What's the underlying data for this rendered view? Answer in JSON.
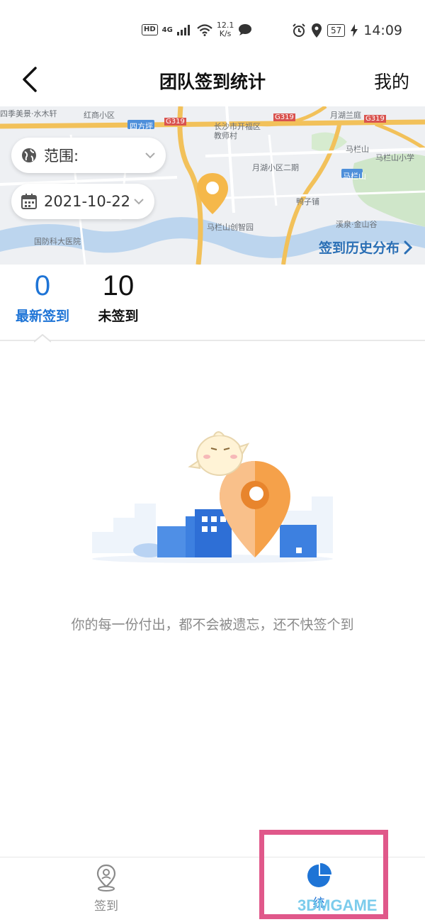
{
  "status_bar": {
    "hd": "HD",
    "network": "4G",
    "speed_value": "12.1",
    "speed_unit": "K/s",
    "battery": "57",
    "time": "14:09"
  },
  "nav": {
    "title": "团队签到统计",
    "right_label": "我的"
  },
  "map": {
    "labels": {
      "l1": "四季美景·水木轩",
      "l2": "红商小区",
      "l3": "四方坪",
      "l4": "长沙市开福区教师村",
      "l5": "月湖兰庭",
      "l6": "马栏山",
      "l7": "马栏山小学",
      "l8": "月湖小区二期",
      "l9": "鸭子铺",
      "l10": "马栏山创智园",
      "l11": "国防科大医院",
      "l12": "溪泉·金山谷",
      "l13": "G319",
      "l14": "G319",
      "l15": "G319",
      "l16": "马栏山"
    },
    "scope_label": "范围:",
    "date_value": "2021-10-22",
    "history_link": "签到历史分布"
  },
  "stats": {
    "latest_count": "0",
    "latest_label": "最新签到",
    "unsigned_count": "10",
    "unsigned_label": "未签到"
  },
  "empty_state": {
    "message": "你的每一份付出，都不会被遗忘，还不快签个到"
  },
  "tab_bar": {
    "tabs": [
      {
        "label": "签到",
        "icon": "location-pin-icon"
      },
      {
        "label": "统",
        "icon": "pie-chart-icon"
      }
    ]
  },
  "watermark": "3DMGAME",
  "colors": {
    "accent_blue": "#1e74d6",
    "link_blue": "#2a6fb5",
    "pin_orange": "#f5a14a",
    "highlight_pink": "#e0588a"
  }
}
